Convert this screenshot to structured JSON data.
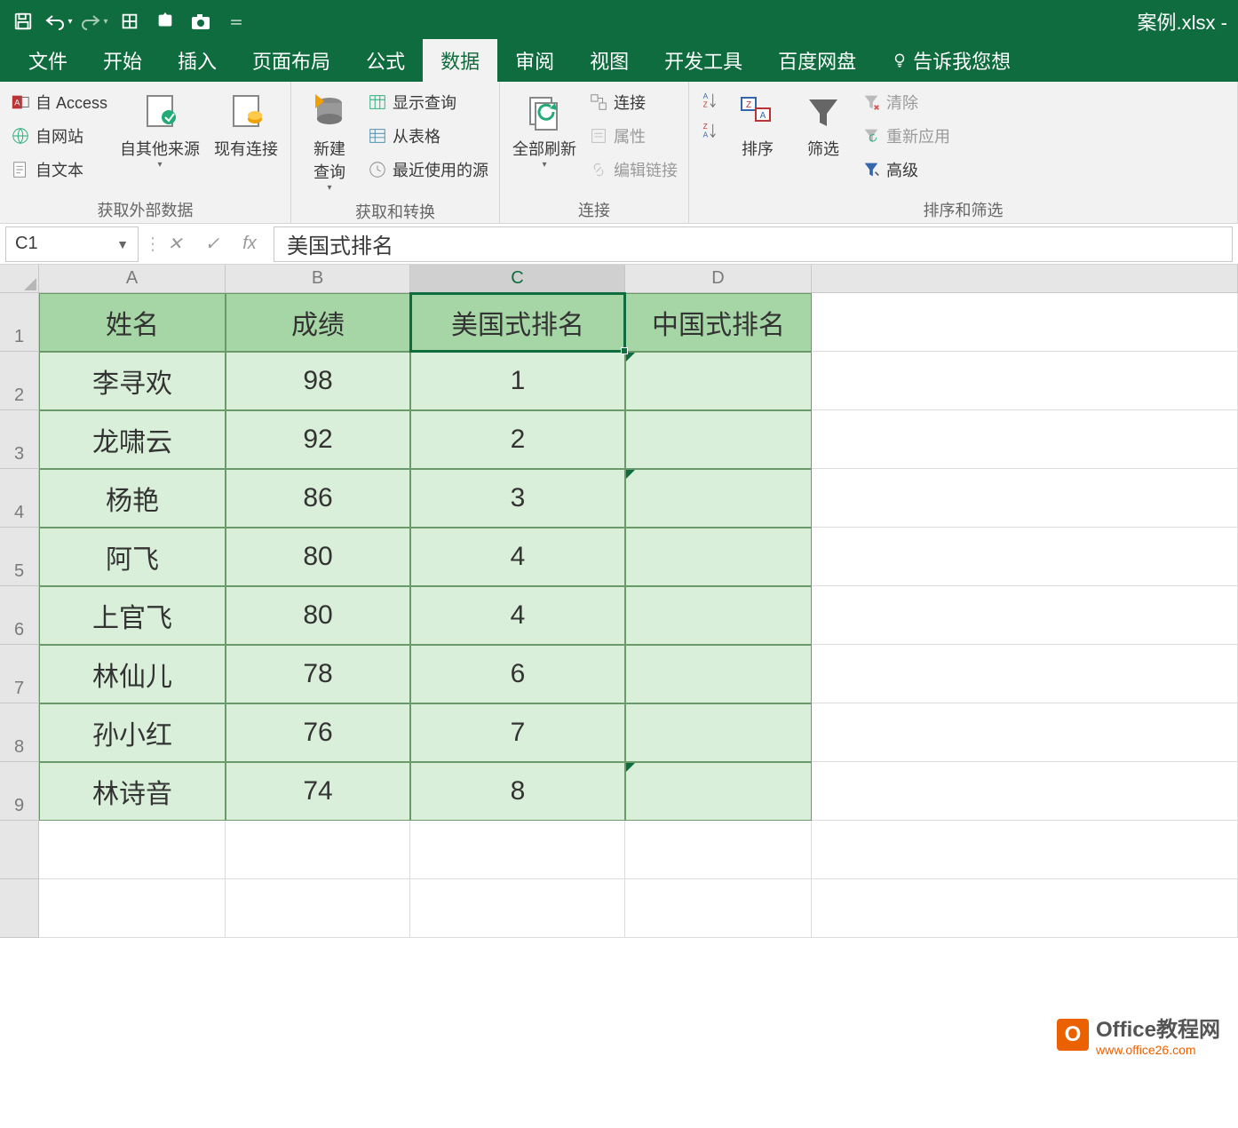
{
  "title": "案例.xlsx -",
  "quick_access": {
    "save_icon": "save",
    "undo_icon": "undo",
    "redo_icon": "redo",
    "touch_icon": "touch-mode",
    "addin1_icon": "addin",
    "camera_icon": "camera",
    "customize_icon": "customize-qat"
  },
  "tabs": {
    "file": "文件",
    "home": "开始",
    "insert": "插入",
    "pagelayout": "页面布局",
    "formulas": "公式",
    "data": "数据",
    "review": "审阅",
    "view": "视图",
    "developer": "开发工具",
    "baidu": "百度网盘",
    "tellme": "告诉我您想"
  },
  "ribbon": {
    "group1": {
      "access": "自 Access",
      "web": "自网站",
      "text": "自文本",
      "other": "自其他来源",
      "existing": "现有连接",
      "label": "获取外部数据"
    },
    "group2": {
      "newquery": "新建\n查询",
      "showqueries": "显示查询",
      "fromtable": "从表格",
      "recent": "最近使用的源",
      "label": "获取和转换"
    },
    "group3": {
      "refreshall": "全部刷新",
      "connections": "连接",
      "properties": "属性",
      "editlinks": "编辑链接",
      "label": "连接"
    },
    "group4": {
      "sortaz": "升序",
      "sortza": "降序",
      "sort": "排序",
      "filter": "筛选",
      "clear": "清除",
      "reapply": "重新应用",
      "advanced": "高级",
      "label": "排序和筛选"
    }
  },
  "formula_bar": {
    "namebox": "C1",
    "cancel": "✕",
    "enter": "✓",
    "fx": "fx",
    "content": "美国式排名"
  },
  "columns": [
    "A",
    "B",
    "C",
    "D"
  ],
  "table": {
    "headers": {
      "A": "姓名",
      "B": "成绩",
      "C": "美国式排名",
      "D": "中国式排名"
    },
    "rows": [
      {
        "A": "李寻欢",
        "B": "98",
        "C": "1",
        "D": ""
      },
      {
        "A": "龙啸云",
        "B": "92",
        "C": "2",
        "D": ""
      },
      {
        "A": "杨艳",
        "B": "86",
        "C": "3",
        "D": ""
      },
      {
        "A": "阿飞",
        "B": "80",
        "C": "4",
        "D": ""
      },
      {
        "A": "上官飞",
        "B": "80",
        "C": "4",
        "D": ""
      },
      {
        "A": "林仙儿",
        "B": "78",
        "C": "6",
        "D": ""
      },
      {
        "A": "孙小红",
        "B": "76",
        "C": "7",
        "D": ""
      },
      {
        "A": "林诗音",
        "B": "74",
        "C": "8",
        "D": ""
      }
    ]
  },
  "row_numbers": [
    "1",
    "2",
    "3",
    "4",
    "5",
    "6",
    "7",
    "8",
    "9"
  ],
  "watermark": {
    "line1": "Office教程网",
    "line2": "www.office26.com"
  }
}
